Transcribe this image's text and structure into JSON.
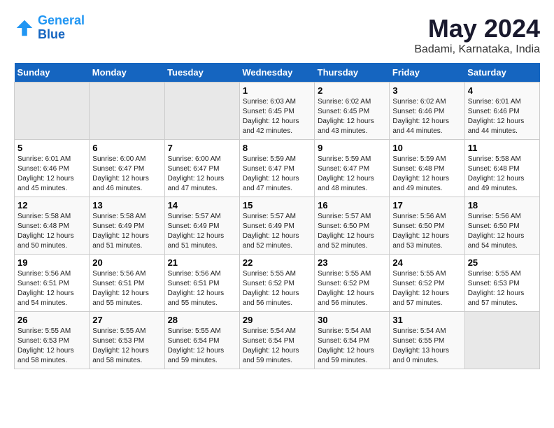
{
  "header": {
    "logo_line1": "General",
    "logo_line2": "Blue",
    "month": "May 2024",
    "location": "Badami, Karnataka, India"
  },
  "days_of_week": [
    "Sunday",
    "Monday",
    "Tuesday",
    "Wednesday",
    "Thursday",
    "Friday",
    "Saturday"
  ],
  "weeks": [
    [
      {
        "day": "",
        "info": ""
      },
      {
        "day": "",
        "info": ""
      },
      {
        "day": "",
        "info": ""
      },
      {
        "day": "1",
        "info": "Sunrise: 6:03 AM\nSunset: 6:45 PM\nDaylight: 12 hours\nand 42 minutes."
      },
      {
        "day": "2",
        "info": "Sunrise: 6:02 AM\nSunset: 6:45 PM\nDaylight: 12 hours\nand 43 minutes."
      },
      {
        "day": "3",
        "info": "Sunrise: 6:02 AM\nSunset: 6:46 PM\nDaylight: 12 hours\nand 44 minutes."
      },
      {
        "day": "4",
        "info": "Sunrise: 6:01 AM\nSunset: 6:46 PM\nDaylight: 12 hours\nand 44 minutes."
      }
    ],
    [
      {
        "day": "5",
        "info": "Sunrise: 6:01 AM\nSunset: 6:46 PM\nDaylight: 12 hours\nand 45 minutes."
      },
      {
        "day": "6",
        "info": "Sunrise: 6:00 AM\nSunset: 6:47 PM\nDaylight: 12 hours\nand 46 minutes."
      },
      {
        "day": "7",
        "info": "Sunrise: 6:00 AM\nSunset: 6:47 PM\nDaylight: 12 hours\nand 47 minutes."
      },
      {
        "day": "8",
        "info": "Sunrise: 5:59 AM\nSunset: 6:47 PM\nDaylight: 12 hours\nand 47 minutes."
      },
      {
        "day": "9",
        "info": "Sunrise: 5:59 AM\nSunset: 6:47 PM\nDaylight: 12 hours\nand 48 minutes."
      },
      {
        "day": "10",
        "info": "Sunrise: 5:59 AM\nSunset: 6:48 PM\nDaylight: 12 hours\nand 49 minutes."
      },
      {
        "day": "11",
        "info": "Sunrise: 5:58 AM\nSunset: 6:48 PM\nDaylight: 12 hours\nand 49 minutes."
      }
    ],
    [
      {
        "day": "12",
        "info": "Sunrise: 5:58 AM\nSunset: 6:48 PM\nDaylight: 12 hours\nand 50 minutes."
      },
      {
        "day": "13",
        "info": "Sunrise: 5:58 AM\nSunset: 6:49 PM\nDaylight: 12 hours\nand 51 minutes."
      },
      {
        "day": "14",
        "info": "Sunrise: 5:57 AM\nSunset: 6:49 PM\nDaylight: 12 hours\nand 51 minutes."
      },
      {
        "day": "15",
        "info": "Sunrise: 5:57 AM\nSunset: 6:49 PM\nDaylight: 12 hours\nand 52 minutes."
      },
      {
        "day": "16",
        "info": "Sunrise: 5:57 AM\nSunset: 6:50 PM\nDaylight: 12 hours\nand 52 minutes."
      },
      {
        "day": "17",
        "info": "Sunrise: 5:56 AM\nSunset: 6:50 PM\nDaylight: 12 hours\nand 53 minutes."
      },
      {
        "day": "18",
        "info": "Sunrise: 5:56 AM\nSunset: 6:50 PM\nDaylight: 12 hours\nand 54 minutes."
      }
    ],
    [
      {
        "day": "19",
        "info": "Sunrise: 5:56 AM\nSunset: 6:51 PM\nDaylight: 12 hours\nand 54 minutes."
      },
      {
        "day": "20",
        "info": "Sunrise: 5:56 AM\nSunset: 6:51 PM\nDaylight: 12 hours\nand 55 minutes."
      },
      {
        "day": "21",
        "info": "Sunrise: 5:56 AM\nSunset: 6:51 PM\nDaylight: 12 hours\nand 55 minutes."
      },
      {
        "day": "22",
        "info": "Sunrise: 5:55 AM\nSunset: 6:52 PM\nDaylight: 12 hours\nand 56 minutes."
      },
      {
        "day": "23",
        "info": "Sunrise: 5:55 AM\nSunset: 6:52 PM\nDaylight: 12 hours\nand 56 minutes."
      },
      {
        "day": "24",
        "info": "Sunrise: 5:55 AM\nSunset: 6:52 PM\nDaylight: 12 hours\nand 57 minutes."
      },
      {
        "day": "25",
        "info": "Sunrise: 5:55 AM\nSunset: 6:53 PM\nDaylight: 12 hours\nand 57 minutes."
      }
    ],
    [
      {
        "day": "26",
        "info": "Sunrise: 5:55 AM\nSunset: 6:53 PM\nDaylight: 12 hours\nand 58 minutes."
      },
      {
        "day": "27",
        "info": "Sunrise: 5:55 AM\nSunset: 6:53 PM\nDaylight: 12 hours\nand 58 minutes."
      },
      {
        "day": "28",
        "info": "Sunrise: 5:55 AM\nSunset: 6:54 PM\nDaylight: 12 hours\nand 59 minutes."
      },
      {
        "day": "29",
        "info": "Sunrise: 5:54 AM\nSunset: 6:54 PM\nDaylight: 12 hours\nand 59 minutes."
      },
      {
        "day": "30",
        "info": "Sunrise: 5:54 AM\nSunset: 6:54 PM\nDaylight: 12 hours\nand 59 minutes."
      },
      {
        "day": "31",
        "info": "Sunrise: 5:54 AM\nSunset: 6:55 PM\nDaylight: 13 hours\nand 0 minutes."
      },
      {
        "day": "",
        "info": ""
      }
    ]
  ]
}
